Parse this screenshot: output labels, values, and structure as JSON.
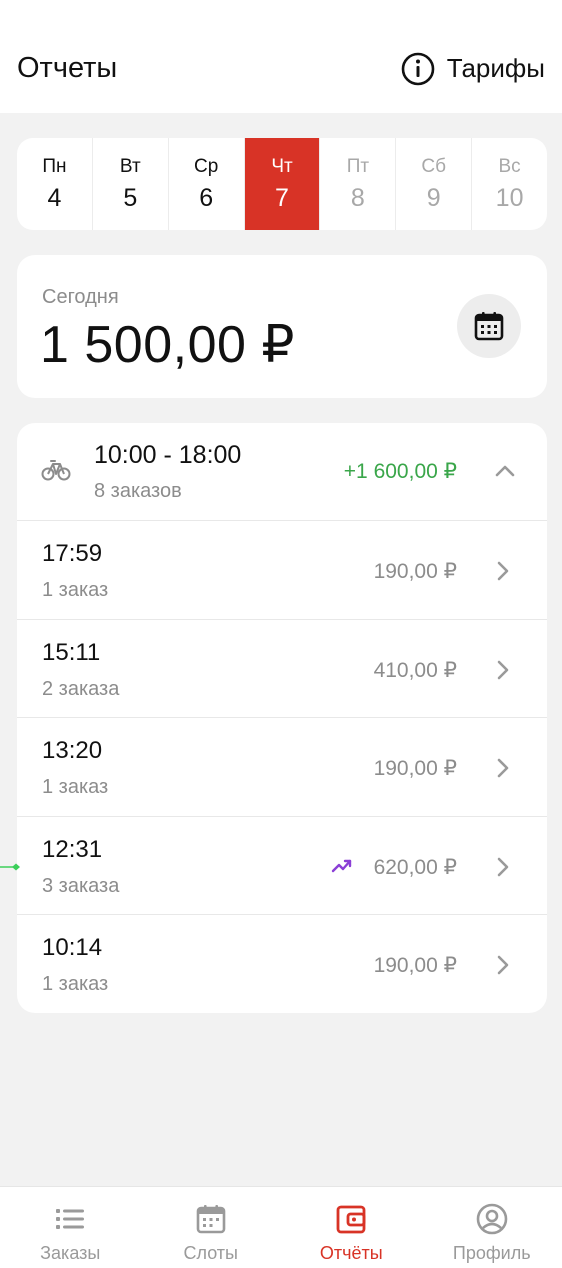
{
  "header": {
    "title": "Отчеты",
    "tariffs_label": "Тарифы"
  },
  "week": [
    {
      "name": "Пн",
      "num": "4",
      "state": "past"
    },
    {
      "name": "Вт",
      "num": "5",
      "state": "past"
    },
    {
      "name": "Ср",
      "num": "6",
      "state": "past"
    },
    {
      "name": "Чт",
      "num": "7",
      "state": "active"
    },
    {
      "name": "Пт",
      "num": "8",
      "state": "future"
    },
    {
      "name": "Сб",
      "num": "9",
      "state": "future"
    },
    {
      "name": "Вс",
      "num": "10",
      "state": "future"
    }
  ],
  "today": {
    "label": "Сегодня",
    "amount": "1 500,00 ₽"
  },
  "slot": {
    "time": "10:00 - 18:00",
    "orders": "8 заказов",
    "total": "+1 600,00 ₽"
  },
  "orders": [
    {
      "time": "17:59",
      "count": "1 заказ",
      "amount": "190,00 ₽",
      "trend": false
    },
    {
      "time": "15:11",
      "count": "2 заказа",
      "amount": "410,00 ₽",
      "trend": false
    },
    {
      "time": "13:20",
      "count": "1 заказ",
      "amount": "190,00 ₽",
      "trend": false
    },
    {
      "time": "12:31",
      "count": "3 заказа",
      "amount": "620,00 ₽",
      "trend": true
    },
    {
      "time": "10:14",
      "count": "1 заказ",
      "amount": "190,00 ₽",
      "trend": false
    }
  ],
  "tabs": [
    {
      "label": "Заказы",
      "icon": "list-icon"
    },
    {
      "label": "Слоты",
      "icon": "calendar-icon"
    },
    {
      "label": "Отчёты",
      "icon": "wallet-icon"
    },
    {
      "label": "Профиль",
      "icon": "profile-icon"
    }
  ],
  "colors": {
    "accent": "#d83326",
    "positive": "#3aa64a",
    "trend": "#8b3fd6",
    "muted": "#8c8c8c"
  }
}
